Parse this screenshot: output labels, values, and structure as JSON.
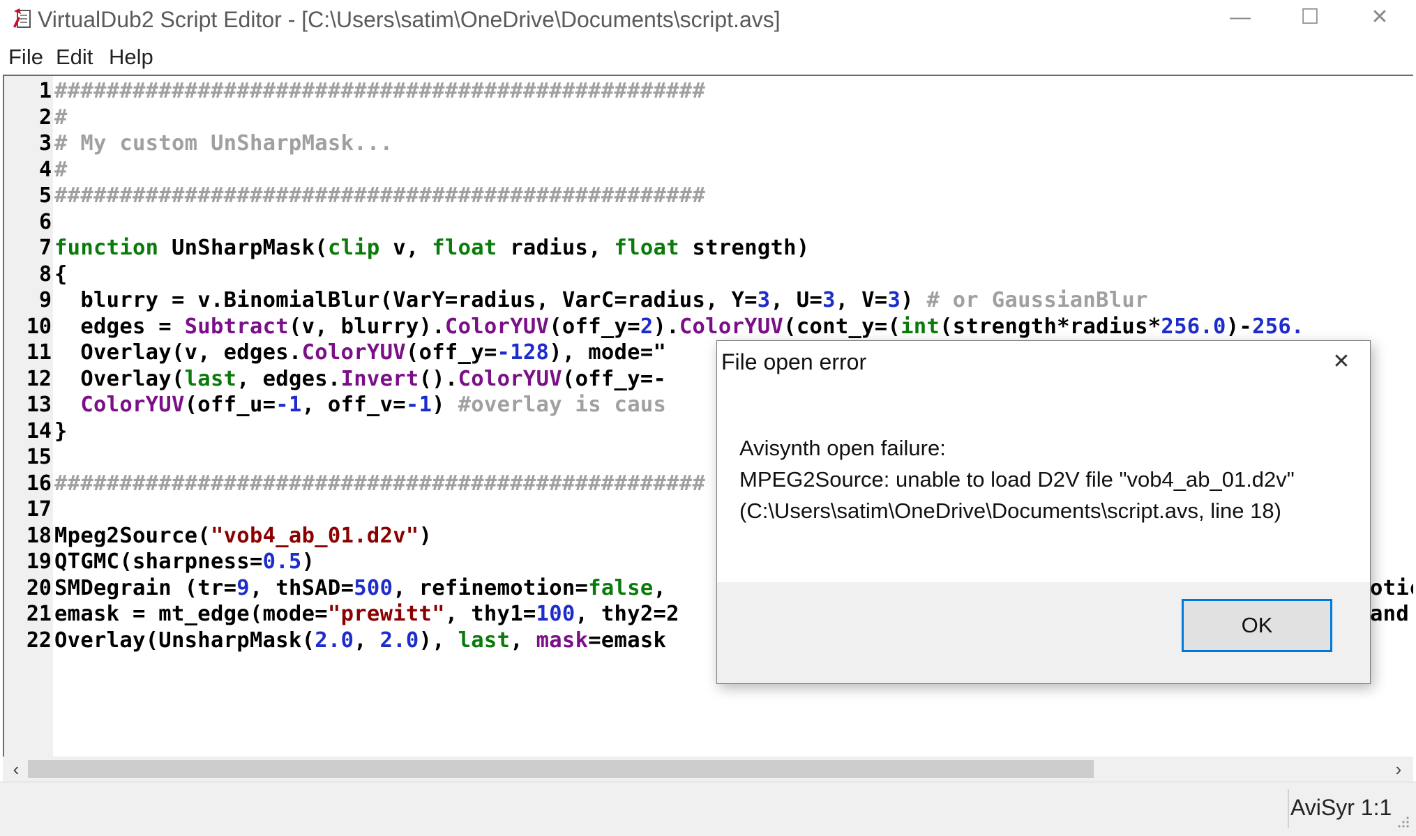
{
  "window": {
    "title": "VirtualDub2 Script Editor - [C:\\Users\\satim\\OneDrive\\Documents\\script.avs]",
    "controls": {
      "minimize": "—",
      "maximize": "☐",
      "close": "✕"
    }
  },
  "menu": [
    "File",
    "Edit",
    "Help"
  ],
  "editor": {
    "lines": [
      [
        {
          "t": "##################################################",
          "c": "cm"
        }
      ],
      [
        {
          "t": "#",
          "c": "cm"
        }
      ],
      [
        {
          "t": "# My custom UnSharpMask...",
          "c": "cm"
        }
      ],
      [
        {
          "t": "#",
          "c": "cm"
        }
      ],
      [
        {
          "t": "##################################################",
          "c": "cm"
        }
      ],
      [],
      [
        {
          "t": "function",
          "c": "kw"
        },
        {
          "t": " UnSharpMask("
        },
        {
          "t": "clip",
          "c": "kw"
        },
        {
          "t": " v, "
        },
        {
          "t": "float",
          "c": "kw"
        },
        {
          "t": " radius, "
        },
        {
          "t": "float",
          "c": "kw"
        },
        {
          "t": " strength)"
        }
      ],
      [
        {
          "t": "{"
        }
      ],
      [
        {
          "t": "  blurry = v.BinomialBlur(VarY=radius, VarC=radius, Y="
        },
        {
          "t": "3",
          "c": "num"
        },
        {
          "t": ", U="
        },
        {
          "t": "3",
          "c": "num"
        },
        {
          "t": ", V="
        },
        {
          "t": "3",
          "c": "num"
        },
        {
          "t": ") "
        },
        {
          "t": "# or GaussianBlur",
          "c": "cm"
        }
      ],
      [
        {
          "t": "  edges = "
        },
        {
          "t": "Subtract",
          "c": "fn"
        },
        {
          "t": "(v, blurry)."
        },
        {
          "t": "ColorYUV",
          "c": "fn"
        },
        {
          "t": "(off_y="
        },
        {
          "t": "2",
          "c": "num"
        },
        {
          "t": ")."
        },
        {
          "t": "ColorYUV",
          "c": "fn"
        },
        {
          "t": "(cont_y=("
        },
        {
          "t": "int",
          "c": "kw"
        },
        {
          "t": "(strength*radius*"
        },
        {
          "t": "256.0",
          "c": "num"
        },
        {
          "t": ")-"
        },
        {
          "t": "256.",
          "c": "num"
        }
      ],
      [
        {
          "t": "  Overlay(v, edges."
        },
        {
          "t": "ColorYUV",
          "c": "fn"
        },
        {
          "t": "(off_y="
        },
        {
          "t": "-128",
          "c": "num"
        },
        {
          "t": "), mode=\""
        }
      ],
      [
        {
          "t": "  Overlay("
        },
        {
          "t": "last",
          "c": "kw"
        },
        {
          "t": ", edges."
        },
        {
          "t": "Invert",
          "c": "fn"
        },
        {
          "t": "()."
        },
        {
          "t": "ColorYUV",
          "c": "fn"
        },
        {
          "t": "(off_y=-"
        }
      ],
      [
        {
          "t": "  "
        },
        {
          "t": "ColorYUV",
          "c": "fn"
        },
        {
          "t": "(off_u="
        },
        {
          "t": "-1",
          "c": "num"
        },
        {
          "t": ", off_v="
        },
        {
          "t": "-1",
          "c": "num"
        },
        {
          "t": ") "
        },
        {
          "t": "#overlay is caus",
          "c": "cm"
        }
      ],
      [
        {
          "t": "}"
        }
      ],
      [],
      [
        {
          "t": "##################################################",
          "c": "cm"
        }
      ],
      [],
      [
        {
          "t": "Mpeg2Source("
        },
        {
          "t": "\"vob4_ab_01.d2v\"",
          "c": "str"
        },
        {
          "t": ")"
        }
      ],
      [
        {
          "t": "QTGMC(sharpness="
        },
        {
          "t": "0.5",
          "c": "num"
        },
        {
          "t": ")"
        }
      ],
      [
        {
          "t": "SMDegrain (tr="
        },
        {
          "t": "9",
          "c": "num"
        },
        {
          "t": ", thSAD="
        },
        {
          "t": "500",
          "c": "num"
        },
        {
          "t": ", refinemotion="
        },
        {
          "t": "false",
          "c": "kw"
        },
        {
          "t": ","
        }
      ],
      [
        {
          "t": "emask = mt_edge(mode="
        },
        {
          "t": "\"prewitt\"",
          "c": "str"
        },
        {
          "t": ", thy1="
        },
        {
          "t": "100",
          "c": "num"
        },
        {
          "t": ", thy2=2"
        }
      ],
      [
        {
          "t": "Overlay(UnsharpMask("
        },
        {
          "t": "2.0",
          "c": "num"
        },
        {
          "t": ", "
        },
        {
          "t": "2.0",
          "c": "num"
        },
        {
          "t": "), "
        },
        {
          "t": "last",
          "c": "kw"
        },
        {
          "t": ", "
        },
        {
          "t": "mask",
          "c": "fn"
        },
        {
          "t": "=emask"
        }
      ]
    ],
    "overflow_right": [
      {
        "line": 20,
        "t": "otic"
      },
      {
        "line": 21,
        "t": "and"
      }
    ]
  },
  "statusbar": {
    "text": "AviSyr 1:1"
  },
  "dialog": {
    "title": "File open error",
    "close": "✕",
    "message": [
      "Avisynth open failure:",
      "MPEG2Source: unable to load D2V file \"vob4_ab_01.d2v\"",
      "(C:\\Users\\satim\\OneDrive\\Documents\\script.avs, line 18)"
    ],
    "ok_label": "OK"
  },
  "colors": {
    "keyword": "#0a7a0a",
    "function": "#7a0f87",
    "number": "#1d2dcc",
    "string": "#8b0000",
    "comment": "#a0a0a0",
    "focus": "#0078d7"
  }
}
